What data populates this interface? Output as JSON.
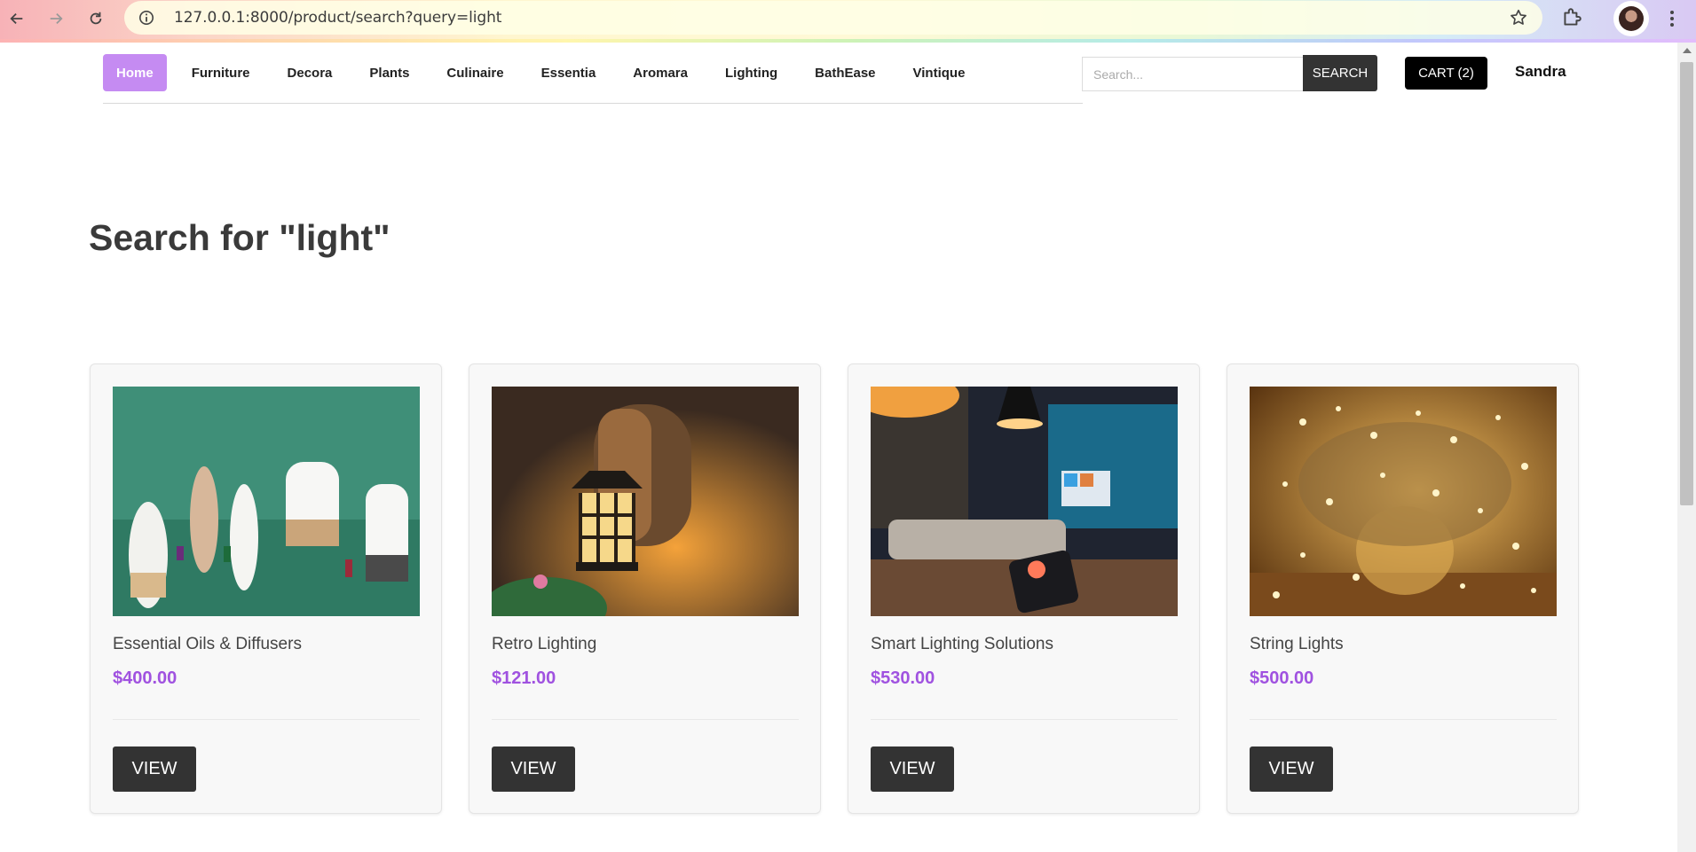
{
  "browser": {
    "url": "127.0.0.1:8000/product/search?query=light"
  },
  "nav": {
    "items": [
      "Home",
      "Furniture",
      "Decora",
      "Plants",
      "Culinaire",
      "Essentia",
      "Aromara",
      "Lighting",
      "BathEase",
      "Vintique"
    ],
    "active": "Home"
  },
  "search": {
    "placeholder": "Search...",
    "button": "SEARCH"
  },
  "cart": {
    "label": "CART (2)"
  },
  "user": {
    "name": "Sandra"
  },
  "page": {
    "title": "Search for \"light\""
  },
  "products": [
    {
      "name": "Essential Oils & Diffusers",
      "price": "$400.00",
      "button": "VIEW",
      "image": "diffusers-image"
    },
    {
      "name": "Retro Lighting",
      "price": "$121.00",
      "button": "VIEW",
      "image": "lantern-image"
    },
    {
      "name": "Smart Lighting Solutions",
      "price": "$530.00",
      "button": "VIEW",
      "image": "smart-living-room-image"
    },
    {
      "name": "String Lights",
      "price": "$500.00",
      "button": "VIEW",
      "image": "string-lights-image"
    }
  ],
  "colors": {
    "accent": "#a052e0",
    "nav_active_bg": "#c58bf2",
    "button_dark": "#333333"
  }
}
